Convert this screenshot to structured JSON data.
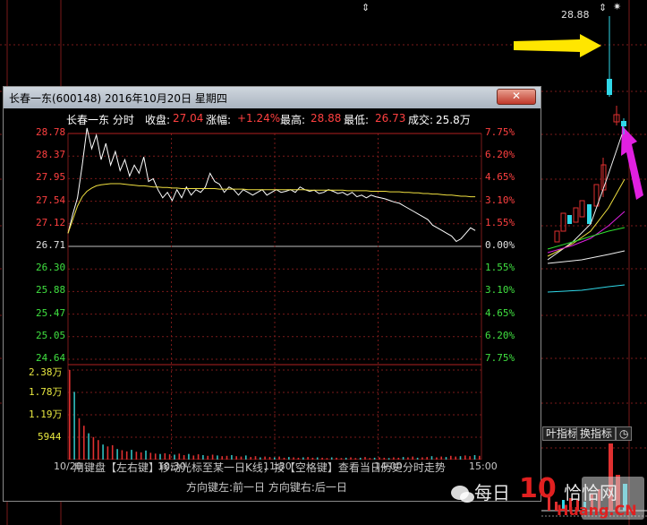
{
  "background_chart": {
    "high_price_label": "28.88",
    "top_markers": [
      "⇕",
      "⇕",
      "✷"
    ],
    "tab_buttons": [
      "叶指标",
      "换指标",
      "◷"
    ]
  },
  "dialog": {
    "title": "长春一东(600148) 2016年10月20日 星期四",
    "close_label": "✕",
    "info_bar": {
      "name_mode": "长春一东 分时",
      "close_label": "收盘:",
      "close_value": "27.04",
      "change_label": "涨幅:",
      "change_value": "+1.24%",
      "high_label": "最高:",
      "high_value": "28.88",
      "low_label": "最低:",
      "low_value": "26.73",
      "volume_label": "成交:",
      "volume_value": "25.8万"
    },
    "hint_line1": "用键盘【左右键】移动光标至某一日K线，按【空格键】查看当日历史分时走势",
    "hint_line2": "方向键左:前一日    方向键右:后一日"
  },
  "chart_data": {
    "type": "line",
    "title": "长春一东 分时",
    "reference_price": 26.71,
    "price_ticks": [
      "28.78",
      "28.37",
      "27.95",
      "27.54",
      "27.12",
      "26.71",
      "26.30",
      "25.88",
      "25.47",
      "25.05",
      "24.64"
    ],
    "percent_ticks": [
      "7.75%",
      "6.20%",
      "4.65%",
      "3.10%",
      "1.55%",
      "0.00%",
      "1.55%",
      "3.10%",
      "4.65%",
      "6.20%",
      "7.75%"
    ],
    "volume_ticks": [
      "2.38万",
      "1.78万",
      "1.19万",
      "5944"
    ],
    "x_ticks": [
      "10/20",
      "10:30",
      "11:30",
      "14:00",
      "15:00"
    ],
    "ylim": [
      24.64,
      28.78
    ],
    "series": [
      {
        "name": "价格",
        "color": "#ffffff",
        "values": [
          26.95,
          27.3,
          27.6,
          28.2,
          28.88,
          28.5,
          28.75,
          28.3,
          28.6,
          28.2,
          28.45,
          28.1,
          28.3,
          28.0,
          28.2,
          28.05,
          28.35,
          27.9,
          27.95,
          27.75,
          27.6,
          27.7,
          27.55,
          27.75,
          27.6,
          27.8,
          27.65,
          27.75,
          27.7,
          27.8,
          28.05,
          27.9,
          27.85,
          27.7,
          27.8,
          27.75,
          27.65,
          27.75,
          27.7,
          27.65,
          27.7,
          27.75,
          27.65,
          27.7,
          27.75,
          27.7,
          27.72,
          27.75,
          27.7,
          27.8,
          27.75,
          27.72,
          27.74,
          27.68,
          27.7,
          27.75,
          27.72,
          27.68,
          27.7,
          27.65,
          27.7,
          27.62,
          27.65,
          27.6,
          27.65,
          27.62,
          27.6,
          27.58,
          27.55,
          27.52,
          27.5,
          27.45,
          27.4,
          27.35,
          27.3,
          27.25,
          27.2,
          27.1,
          27.05,
          27.0,
          26.95,
          26.9,
          26.8,
          26.85,
          26.95,
          27.05,
          27.0
        ]
      },
      {
        "name": "均价",
        "color": "#f0e040",
        "values": [
          26.95,
          27.2,
          27.45,
          27.62,
          27.72,
          27.78,
          27.82,
          27.84,
          27.85,
          27.86,
          27.86,
          27.86,
          27.85,
          27.84,
          27.83,
          27.82,
          27.82,
          27.81,
          27.8,
          27.8,
          27.79,
          27.79,
          27.78,
          27.78,
          27.77,
          27.77,
          27.77,
          27.77,
          27.77,
          27.77,
          27.77,
          27.77,
          27.76,
          27.76,
          27.76,
          27.76,
          27.76,
          27.76,
          27.75,
          27.75,
          27.75,
          27.75,
          27.75,
          27.75,
          27.75,
          27.75,
          27.75,
          27.75,
          27.75,
          27.75,
          27.75,
          27.74,
          27.74,
          27.74,
          27.74,
          27.74,
          27.74,
          27.74,
          27.74,
          27.73,
          27.73,
          27.73,
          27.73,
          27.73,
          27.72,
          27.72,
          27.72,
          27.72,
          27.71,
          27.71,
          27.71,
          27.7,
          27.7,
          27.69,
          27.69,
          27.68,
          27.68,
          27.67,
          27.67,
          27.66,
          27.65,
          27.65,
          27.64,
          27.63,
          27.63,
          27.62,
          27.62
        ]
      }
    ],
    "volume": [
      23800,
      18000,
      11000,
      9000,
      7000,
      6000,
      5200,
      4000,
      3500,
      3800,
      2800,
      2500,
      2200,
      2600,
      2100,
      1900,
      2400,
      1800,
      1600,
      1500,
      1700,
      1400,
      1300,
      1600,
      1200,
      1500,
      1100,
      1400,
      1200,
      1000,
      1300,
      1100,
      900,
      1000,
      1200,
      900,
      800,
      1100,
      700,
      900,
      600,
      800,
      700,
      600,
      800,
      500,
      700,
      600,
      500,
      600,
      700,
      500,
      600,
      500,
      400,
      600,
      500,
      400,
      500,
      600,
      400,
      500,
      700,
      400,
      500,
      600,
      500,
      400,
      600,
      500,
      700,
      600,
      800,
      500,
      600,
      700,
      900,
      600,
      800,
      700,
      1000,
      800,
      900,
      1100,
      900,
      1200,
      1000
    ],
    "volume_colors": [
      "#e03030",
      "#30c0c0",
      "#e03030"
    ]
  },
  "watermark": {
    "line1": "每日",
    "line2": "10",
    "line3": "恰恰网",
    "line4": "Huang.CN"
  }
}
